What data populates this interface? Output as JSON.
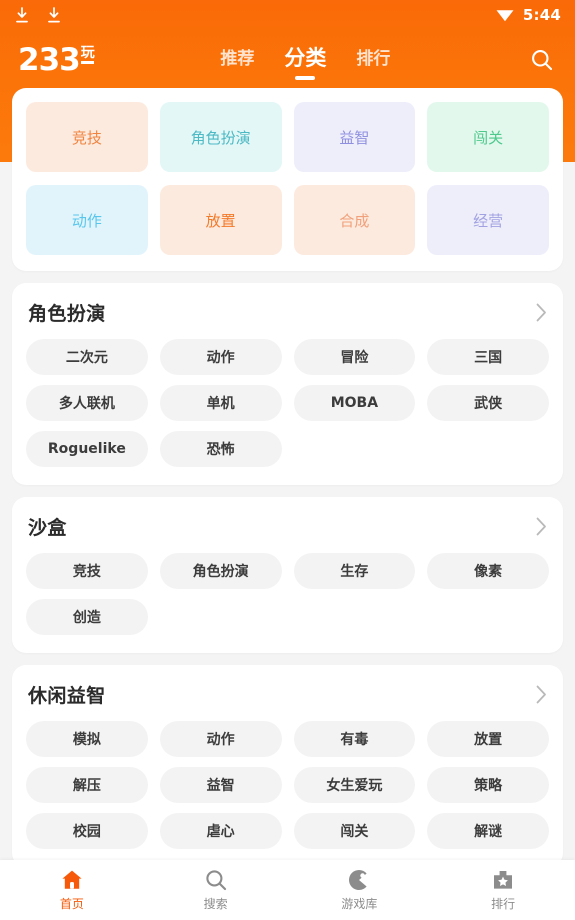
{
  "status_bar": {
    "download_icon_1": "download-icon",
    "download_icon_2": "download-icon",
    "wifi_icon": "wifi-icon",
    "time": "5:44"
  },
  "header": {
    "logo_number": "233",
    "logo_suffix": "玩",
    "search_icon": "search-icon",
    "accent_color": "#fa6a08",
    "tabs": [
      {
        "label": "推荐",
        "active": false
      },
      {
        "label": "分类",
        "active": true
      },
      {
        "label": "排行",
        "active": false
      }
    ]
  },
  "quick_grid": [
    {
      "label": "竞技",
      "bg": "#fdeade",
      "fg": "#f0833f"
    },
    {
      "label": "角色扮演",
      "bg": "#e3f7f7",
      "fg": "#4cb9c4"
    },
    {
      "label": "益智",
      "bg": "#eeeefb",
      "fg": "#8f8fe0"
    },
    {
      "label": "闯关",
      "bg": "#e2f8ed",
      "fg": "#4dc98c"
    },
    {
      "label": "动作",
      "bg": "#e2f4fb",
      "fg": "#58c6ec"
    },
    {
      "label": "放置",
      "bg": "#fdeade",
      "fg": "#f37a2a"
    },
    {
      "label": "合成",
      "bg": "#fdeade",
      "fg": "#f0a07a"
    },
    {
      "label": "经营",
      "bg": "#eeeefb",
      "fg": "#a2a2e2"
    }
  ],
  "sections": [
    {
      "title": "角色扮演",
      "chevron": "chevron-right-icon",
      "tags": [
        "二次元",
        "动作",
        "冒险",
        "三国",
        "多人联机",
        "单机",
        "MOBA",
        "武侠",
        "Roguelike",
        "恐怖"
      ]
    },
    {
      "title": "沙盒",
      "chevron": "chevron-right-icon",
      "tags": [
        "竞技",
        "角色扮演",
        "生存",
        "像素",
        "创造"
      ]
    },
    {
      "title": "休闲益智",
      "chevron": "chevron-right-icon",
      "tags": [
        "模拟",
        "动作",
        "有毒",
        "放置",
        "解压",
        "益智",
        "女生爱玩",
        "策略",
        "校园",
        "虐心",
        "闯关",
        "解谜"
      ]
    }
  ],
  "bottom_nav": [
    {
      "label": "首页",
      "icon": "home-icon",
      "active": true
    },
    {
      "label": "搜索",
      "icon": "search-icon",
      "active": false
    },
    {
      "label": "游戏库",
      "icon": "pacman-icon",
      "active": false
    },
    {
      "label": "排行",
      "icon": "ranking-icon",
      "active": false
    }
  ]
}
